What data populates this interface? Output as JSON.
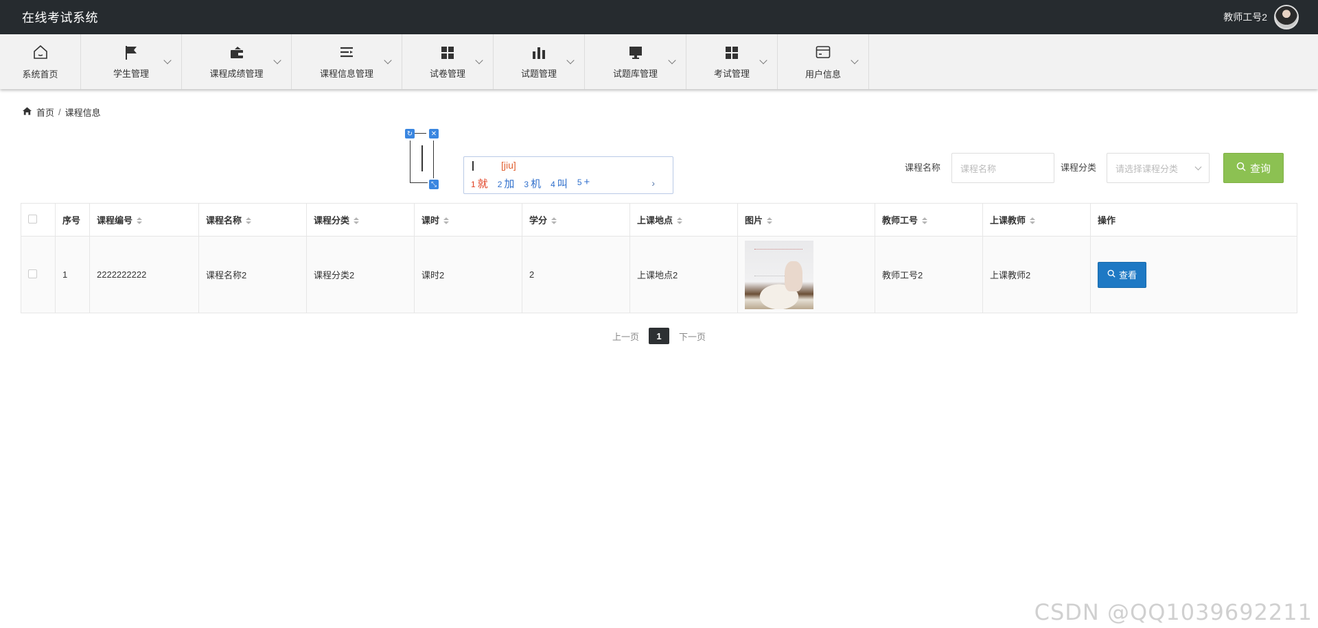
{
  "header": {
    "app_title": "在线考试系统",
    "user_name": "教师工号2"
  },
  "menu": {
    "items": [
      {
        "label": "系统首页",
        "icon": "home-icon"
      },
      {
        "label": "学生管理",
        "icon": "flag-icon"
      },
      {
        "label": "课程成绩管理",
        "icon": "wallet-icon"
      },
      {
        "label": "课程信息管理",
        "icon": "list-icon"
      },
      {
        "label": "试卷管理",
        "icon": "grid-icon"
      },
      {
        "label": "试题管理",
        "icon": "bar-chart-icon"
      },
      {
        "label": "试题库管理",
        "icon": "monitor-icon"
      },
      {
        "label": "考试管理",
        "icon": "grid-icon"
      },
      {
        "label": "用户信息",
        "icon": "card-icon"
      }
    ]
  },
  "breadcrumb": {
    "home": "首页",
    "separator": "/",
    "current": "课程信息"
  },
  "search": {
    "name_label": "课程名称",
    "name_placeholder": "课程名称",
    "category_label": "课程分类",
    "category_placeholder": "请选择课程分类",
    "query_button": "查询"
  },
  "ime": {
    "pinyin": "[jiu]",
    "candidates": [
      {
        "num": "1",
        "text": "就"
      },
      {
        "num": "2",
        "text": "加"
      },
      {
        "num": "3",
        "text": "机"
      },
      {
        "num": "4",
        "text": "叫"
      },
      {
        "num": "5",
        "text": "+"
      }
    ],
    "next": "›"
  },
  "table": {
    "columns": [
      "序号",
      "课程编号",
      "课程名称",
      "课程分类",
      "课时",
      "学分",
      "上课地点",
      "图片",
      "教师工号",
      "上课教师",
      "操作"
    ],
    "rows": [
      {
        "index": "1",
        "course_no": "2222222222",
        "course_name": "课程名称2",
        "category": "课程分类2",
        "hours": "课时2",
        "credit": "2",
        "location": "上课地点2",
        "teacher_no": "教师工号2",
        "teacher": "上课教师2",
        "action": "查看"
      }
    ]
  },
  "pager": {
    "prev": "上一页",
    "current": "1",
    "next": "下一页"
  },
  "watermark": "CSDN @QQ1039692211",
  "colors": {
    "topbar": "#262b2f",
    "query_button": "#8cc152",
    "view_button": "#1e79c4"
  }
}
